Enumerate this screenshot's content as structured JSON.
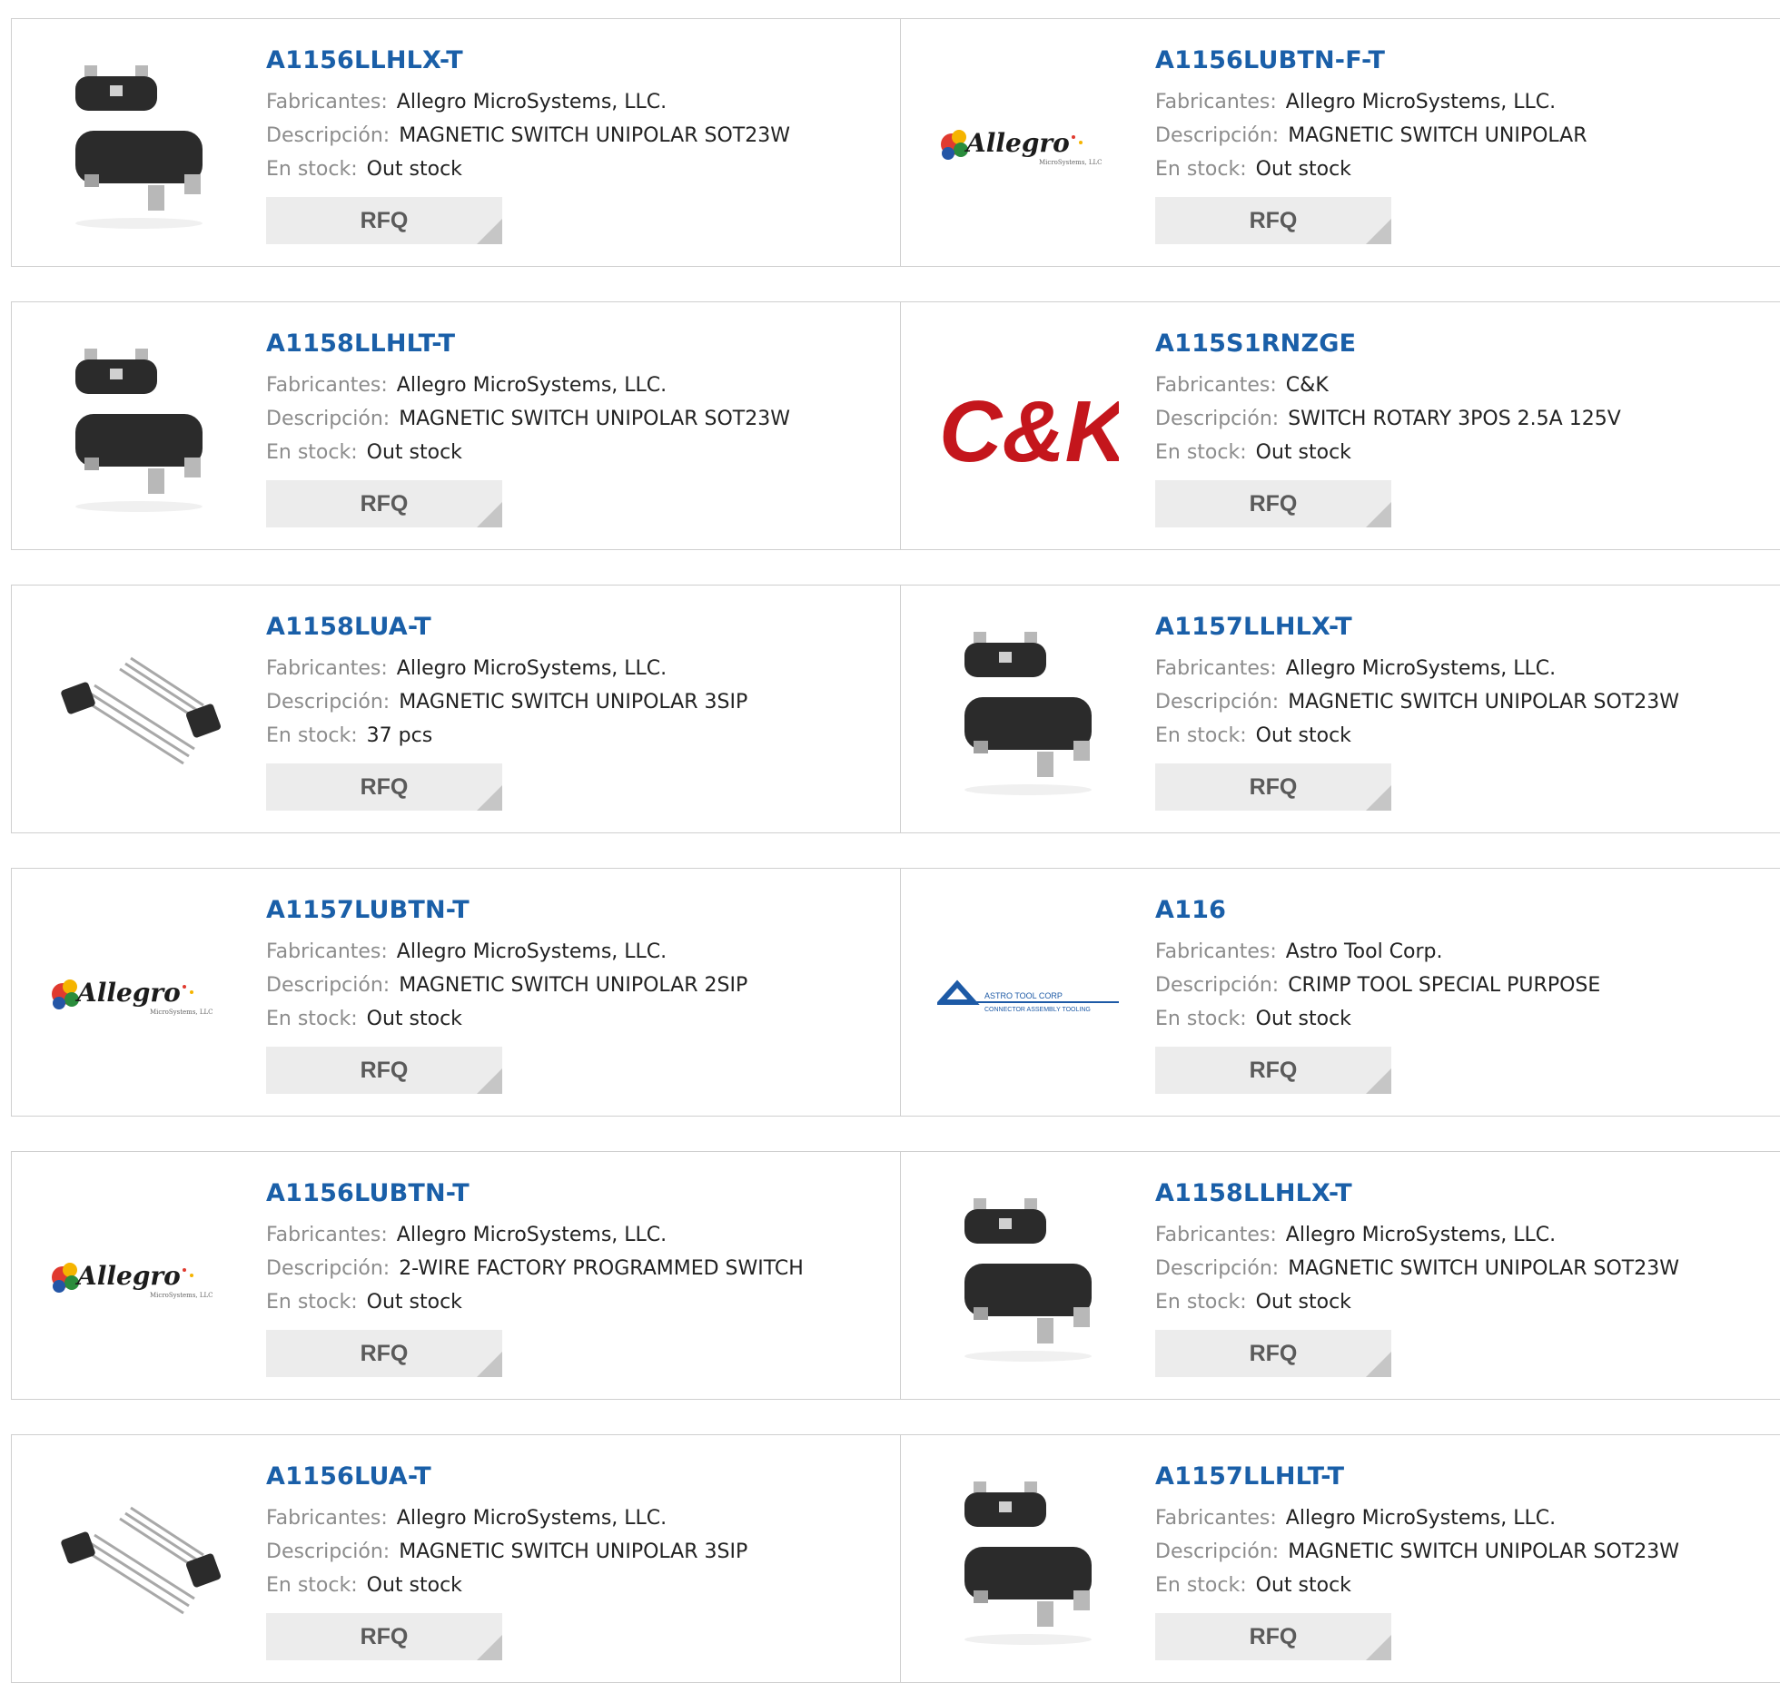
{
  "labels": {
    "manufacturer": "Fabricantes:",
    "description": "Descripción:",
    "stock": "En stock:"
  },
  "rfq_label": "RFQ",
  "brand": {
    "link_color": "#1a5fa8"
  },
  "logos": {
    "allegro": {
      "name": "Allegro",
      "sub": "MicroSystems, LLC"
    },
    "ck": {
      "name": "C&K"
    },
    "astro": {
      "name": "ASTRO TOOL CORP",
      "sub": "CONNECTOR ASSEMBLY TOOLING"
    }
  },
  "products": [
    {
      "part": "A1156LLHLX-T",
      "manufacturer": "Allegro MicroSystems, LLC.",
      "description": "MAGNETIC SWITCH UNIPOLAR SOT23W",
      "stock": "Out stock",
      "image": "sot23-chip-icon"
    },
    {
      "part": "A1156LUBTN-F-T",
      "manufacturer": "Allegro MicroSystems, LLC.",
      "description": "MAGNETIC SWITCH UNIPOLAR",
      "stock": "Out stock",
      "image": "allegro-logo"
    },
    {
      "part": "A1158LLHLT-T",
      "manufacturer": "Allegro MicroSystems, LLC.",
      "description": "MAGNETIC SWITCH UNIPOLAR SOT23W",
      "stock": "Out stock",
      "image": "sot23-chip-icon"
    },
    {
      "part": "A115S1RNZGE",
      "manufacturer": "C&K",
      "description": "SWITCH ROTARY 3POS 2.5A 125V",
      "stock": "Out stock",
      "image": "ck-logo"
    },
    {
      "part": "A1158LUA-T",
      "manufacturer": "Allegro MicroSystems, LLC.",
      "description": "MAGNETIC SWITCH UNIPOLAR 3SIP",
      "stock": "37 pcs",
      "image": "sip-transistor-icon"
    },
    {
      "part": "A1157LLHLX-T",
      "manufacturer": "Allegro MicroSystems, LLC.",
      "description": "MAGNETIC SWITCH UNIPOLAR SOT23W",
      "stock": "Out stock",
      "image": "sot23-chip-icon"
    },
    {
      "part": "A1157LUBTN-T",
      "manufacturer": "Allegro MicroSystems, LLC.",
      "description": "MAGNETIC SWITCH UNIPOLAR 2SIP",
      "stock": "Out stock",
      "image": "allegro-logo"
    },
    {
      "part": "A116",
      "manufacturer": "Astro Tool Corp.",
      "description": "CRIMP TOOL SPECIAL PURPOSE",
      "stock": "Out stock",
      "image": "astro-logo"
    },
    {
      "part": "A1156LUBTN-T",
      "manufacturer": "Allegro MicroSystems, LLC.",
      "description": "2-WIRE FACTORY PROGRAMMED SWITCH",
      "stock": "Out stock",
      "image": "allegro-logo"
    },
    {
      "part": "A1158LLHLX-T",
      "manufacturer": "Allegro MicroSystems, LLC.",
      "description": "MAGNETIC SWITCH UNIPOLAR SOT23W",
      "stock": "Out stock",
      "image": "sot23-chip-icon"
    },
    {
      "part": "A1156LUA-T",
      "manufacturer": "Allegro MicroSystems, LLC.",
      "description": "MAGNETIC SWITCH UNIPOLAR 3SIP",
      "stock": "Out stock",
      "image": "sip-transistor-icon"
    },
    {
      "part": "A1157LLHLT-T",
      "manufacturer": "Allegro MicroSystems, LLC.",
      "description": "MAGNETIC SWITCH UNIPOLAR SOT23W",
      "stock": "Out stock",
      "image": "sot23-chip-icon"
    }
  ]
}
